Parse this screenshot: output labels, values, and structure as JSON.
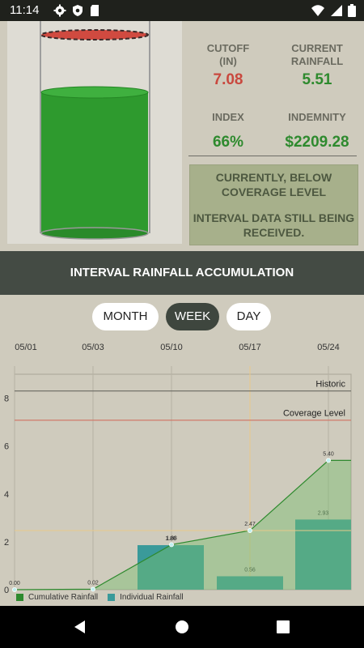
{
  "status": {
    "time": "11:14",
    "icons_left": [
      "gear-icon",
      "shield-icon",
      "sd-card-icon"
    ],
    "icons_right": [
      "wifi-icon",
      "signal-icon",
      "battery-icon"
    ]
  },
  "top_stats": {
    "cutoff_label_line1": "CUTOFF",
    "cutoff_label_line2": "(IN)",
    "cutoff_value": "7.08",
    "current_label_line1": "CURRENT",
    "current_label_line2": "RAINFALL",
    "current_value": "5.51",
    "index_label": "INDEX",
    "index_value": "66%",
    "indemnity_label": "INDEMNITY",
    "indemnity_value": "$2209.28",
    "colors": {
      "red": "#c9483e",
      "green": "#2e8a2e"
    }
  },
  "gauge": {
    "fill_level": 0.66,
    "fill_color": "#2e9a2e",
    "cutoff_color": "#d04a40"
  },
  "notice": {
    "line1": "CURRENTLY, BELOW COVERAGE LEVEL",
    "line2": "INTERVAL DATA STILL BEING RECEIVED."
  },
  "section_title": "INTERVAL RAINFALL ACCUMULATION",
  "tabs": [
    {
      "label": "MONTH",
      "active": false
    },
    {
      "label": "WEEK",
      "active": true
    },
    {
      "label": "DAY",
      "active": false
    }
  ],
  "chart_data": {
    "type": "bar",
    "x_tick_labels": [
      "05/01",
      "05/03",
      "05/10",
      "05/17",
      "05/24"
    ],
    "y_ticks": [
      0,
      2,
      4,
      6,
      8
    ],
    "ylim": [
      0,
      9
    ],
    "reference_lines": [
      {
        "name": "Historic",
        "value": 8.3,
        "color": "#6a6a62"
      },
      {
        "name": "Coverage Level",
        "value": 7.08,
        "color": "#d07a6a"
      }
    ],
    "series": [
      {
        "name": "Individual Rainfall",
        "type": "bar",
        "color": "#3a9a9a",
        "values": [
          1.86,
          0.56,
          2.93
        ]
      },
      {
        "name": "Cumulative Rainfall",
        "type": "area",
        "color": "#2e8a2e",
        "values": [
          0.0,
          0.02,
          1.88,
          2.47,
          5.4
        ],
        "labels": [
          "0.00",
          "0.02",
          "1.88",
          "2.47",
          "5.40"
        ]
      }
    ],
    "bar_labels": [
      "1.86",
      "0.56",
      "2.93"
    ],
    "legend": "bottom-left"
  }
}
